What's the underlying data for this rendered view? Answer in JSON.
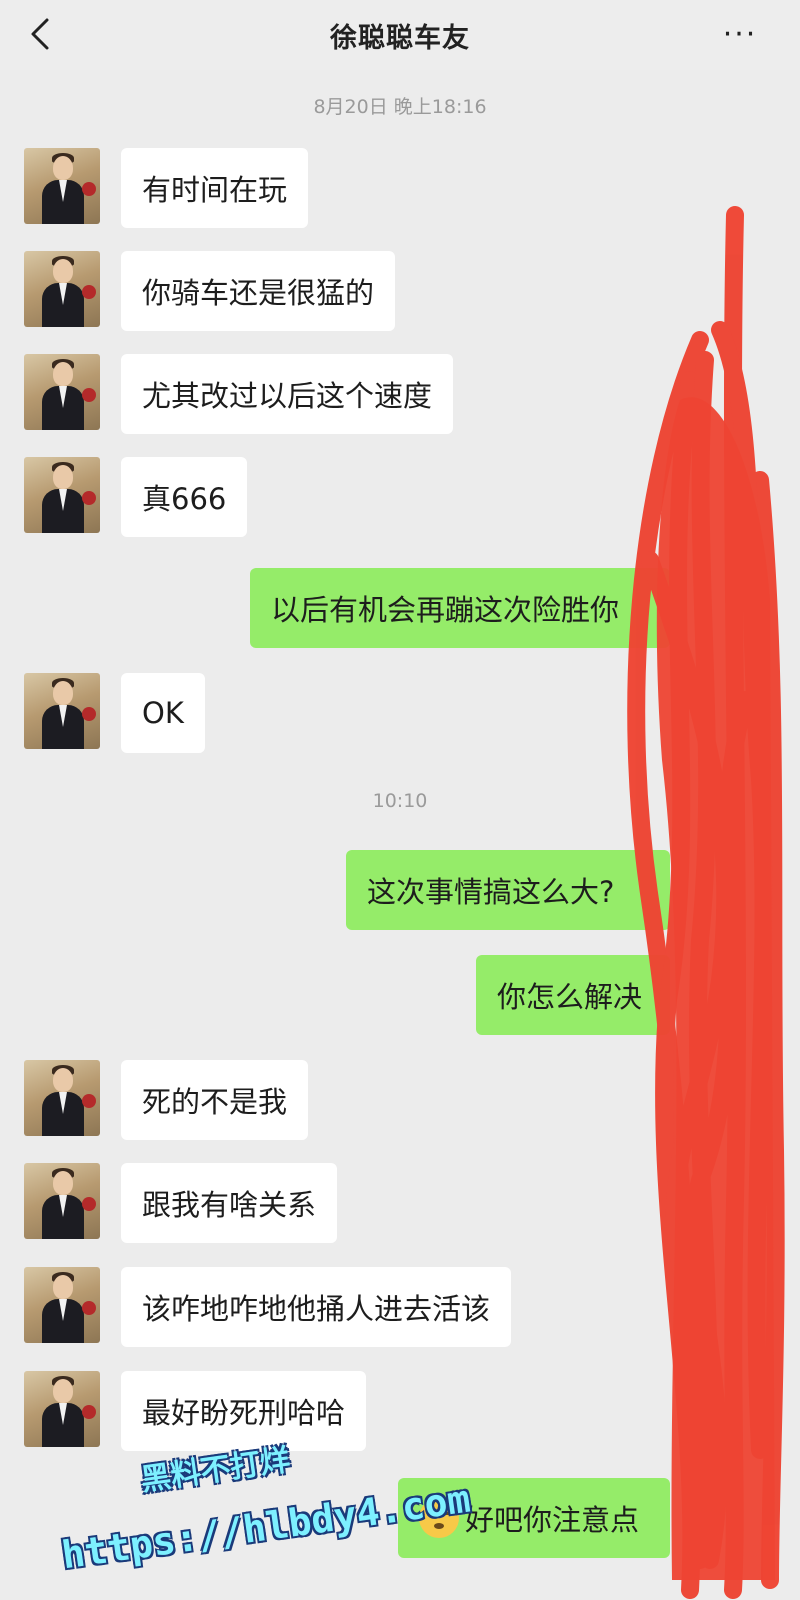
{
  "header": {
    "title": "徐聪聪车友",
    "more": "···"
  },
  "timestamps": [
    "8月20日 晚上18:16",
    "10:10"
  ],
  "messages": [
    {
      "side": "left",
      "text": "有时间在玩"
    },
    {
      "side": "left",
      "text": "你骑车还是很猛的"
    },
    {
      "side": "left",
      "text": "尤其改过以后这个速度"
    },
    {
      "side": "left",
      "text": "真666"
    },
    {
      "side": "right",
      "text": "以后有机会再蹦这次险胜你"
    },
    {
      "side": "left",
      "text": "OK"
    },
    {
      "side": "right",
      "text": "这次事情搞这么大?"
    },
    {
      "side": "right",
      "text": "你怎么解决"
    },
    {
      "side": "left",
      "text": "死的不是我"
    },
    {
      "side": "left",
      "text": "跟我有啥关系"
    },
    {
      "side": "left",
      "text": "该咋地咋地他捅人进去活该"
    },
    {
      "side": "left",
      "text": "最好盼死刑哈哈"
    },
    {
      "side": "right",
      "text": "好吧你注意点",
      "emoji": "unamused-face-icon"
    }
  ],
  "watermark": {
    "line1": "黑料不打烊",
    "line2": "https://hlbdy4.com"
  },
  "colors": {
    "background": "#ececec",
    "left_bubble": "#ffffff",
    "right_bubble": "#95ec69",
    "scribble": "#ee4433"
  }
}
